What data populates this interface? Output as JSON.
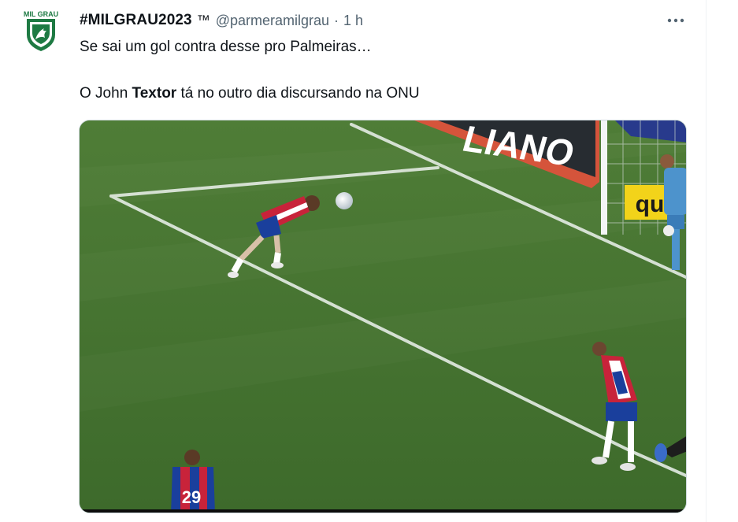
{
  "tweet": {
    "avatar_label": "MIL GRAU",
    "display_name": "#MILGRAU2023",
    "tm": "™",
    "handle": "@parmeramilgrau",
    "separator": "·",
    "time": "1 h",
    "more_icon": "more-horizontal-icon",
    "text_line1": "Se sai um gol contra desse pro Palmeiras…",
    "text_line2_prefix": "O John ",
    "text_line2_bold": "Textor",
    "text_line2_suffix": " tá no outro dia discursando na ONU"
  },
  "media": {
    "banner_text": "LIANO",
    "sponsor_text": "qu",
    "jersey_number": "29"
  },
  "colors": {
    "text_primary": "#0f1419",
    "text_secondary": "#536471",
    "avatar_green": "#1e7a43",
    "pitch_green": "#4c7a35",
    "fortaleza_red": "#c8233a",
    "fortaleza_blue": "#1a3f9c"
  }
}
